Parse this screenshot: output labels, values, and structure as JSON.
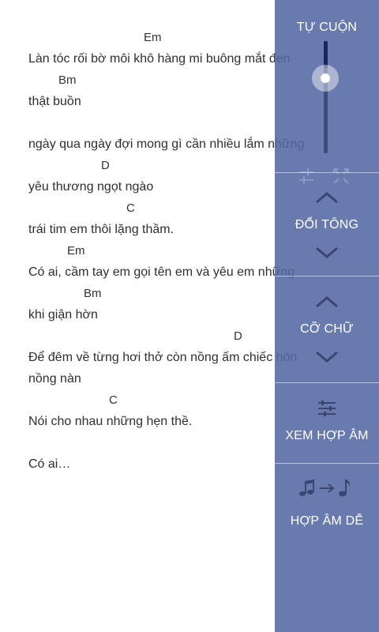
{
  "lyrics": [
    {
      "type": "chord",
      "text": "Em"
    },
    {
      "type": "lyric",
      "text": "Làn tóc rối bờ môi khô hàng mi buông mắt đen"
    },
    {
      "type": "chord",
      "text": "Bm"
    },
    {
      "type": "lyric",
      "text": "thật buồn"
    },
    {
      "type": "lyric",
      "text": "ngày qua ngày đợi mong gì cần nhiều lắm những"
    },
    {
      "type": "chord",
      "text": "D"
    },
    {
      "type": "lyric",
      "text": "yêu thương ngọt ngào"
    },
    {
      "type": "chord",
      "text": "C"
    },
    {
      "type": "lyric",
      "text": "trái tim em thôi lặng thầm."
    },
    {
      "type": "chord",
      "text": "Em"
    },
    {
      "type": "lyric",
      "text": "Có ai, cầm tay em gọi tên em và yêu em những"
    },
    {
      "type": "chord",
      "text": "Bm"
    },
    {
      "type": "lyric",
      "text": "khi giận hờn"
    },
    {
      "type": "chord",
      "text": "D"
    },
    {
      "type": "lyric",
      "text": "Để đêm về từng hơi thở còn nồng ấm chiếc hôn"
    },
    {
      "type": "lyric",
      "text": "nồng nàn"
    },
    {
      "type": "chord",
      "text": "C"
    },
    {
      "type": "lyric",
      "text": "Nói cho nhau những hẹn thề."
    },
    {
      "type": "lyric",
      "text": "Có ai…"
    }
  ],
  "panel": {
    "autoscroll_label": "TỰ CUỘN",
    "autoscroll_level": 0.24,
    "transpose_label": "ĐỔI TÔNG",
    "font_size_label": "CỠ CHỮ",
    "view_chords_label": "XEM HỢP ÂM",
    "easy_chords_label": "HỢP ÂM DỄ"
  },
  "colors": {
    "panel_bg": "#5468a4",
    "slider_fill": "#1c2466",
    "text": "#2f2f2f"
  },
  "icons": [
    "chevron-up-icon",
    "chevron-down-icon",
    "sliders-icon",
    "music-notes-icon",
    "arrow-right-icon",
    "music-note-icon",
    "fullscreen-icon",
    "tune-icon"
  ]
}
